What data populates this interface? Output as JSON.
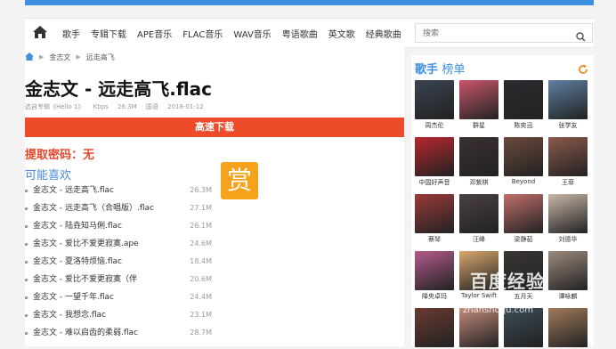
{
  "nav": {
    "items": [
      "歌手",
      "专辑下载",
      "APE音乐",
      "FLAC音乐",
      "WAV音乐",
      "粤语歌曲",
      "英文歌",
      "经典歌曲"
    ],
    "search_placeholder": "搜索"
  },
  "breadcrumb": [
    "金志文",
    "远走高飞"
  ],
  "song": {
    "title": "金志文 - 远走高飞.flac",
    "album": "选自专辑《Hello 1》",
    "bitrate": "Kbps",
    "size": "26.3M",
    "language": "国语",
    "date": "2018-01-12",
    "download_label": "高速下载",
    "password_label": "提取密码：无"
  },
  "reward_label": "赏",
  "maylike_label": "可能喜欢",
  "related": [
    {
      "name": "金志文 - 远走高飞.flac",
      "size": "26.3M"
    },
    {
      "name": "金志文 - 远走高飞（合唱版）.flac",
      "size": "27.1M"
    },
    {
      "name": "金志文 - 陆垚知马俐.flac",
      "size": "26.1M"
    },
    {
      "name": "金志文 - 爱比不爱更寂寞.ape",
      "size": "24.6M"
    },
    {
      "name": "金志文 - 夏洛特烦恼.flac",
      "size": "18.4M"
    },
    {
      "name": "金志文 - 爱比不爱更寂寞（伴",
      "size": "20.6M"
    },
    {
      "name": "金志文 - 一望千年.flac",
      "size": "24.4M"
    },
    {
      "name": "金志文 - 我想念.flac",
      "size": "23.1M"
    },
    {
      "name": "金志文 - 难以启齿的柔弱.flac",
      "size": "28.7M"
    }
  ],
  "sidebar": {
    "title_a": "歌手",
    "title_b": "榜单",
    "artists": [
      {
        "name": "周杰伦",
        "color": "#3a4452"
      },
      {
        "name": "群星",
        "color": "#c9566a"
      },
      {
        "name": "陈奕迅",
        "color": "#2b2b30"
      },
      {
        "name": "张学友",
        "color": "#5f7fa3"
      },
      {
        "name": "中国好声音",
        "color": "#b8262e"
      },
      {
        "name": "邓紫棋",
        "color": "#3b3030"
      },
      {
        "name": "Beyond",
        "color": "#6b4a3c"
      },
      {
        "name": "王菲",
        "color": "#8a5a4a"
      },
      {
        "name": "蔡琴",
        "color": "#9a3a3a"
      },
      {
        "name": "汪峰",
        "color": "#4a4040"
      },
      {
        "name": "梁静茹",
        "color": "#c06f6a"
      },
      {
        "name": "刘德华",
        "color": "#c9b7a8"
      },
      {
        "name": "降央卓玛",
        "color": "#b45a8c"
      },
      {
        "name": "Taylor Swift",
        "color": "#d9a76e"
      },
      {
        "name": "五月天",
        "color": "#3a3535"
      },
      {
        "name": "谭咏麟",
        "color": "#9c8a7c"
      },
      {
        "name": "",
        "color": "#6a3a30"
      },
      {
        "name": "",
        "color": "#c58a7a"
      },
      {
        "name": "",
        "color": "#3c4c56"
      },
      {
        "name": "",
        "color": "#a07a5a"
      }
    ]
  },
  "watermark": {
    "main": "百度经验",
    "sub": "zhanshoqu.com"
  }
}
